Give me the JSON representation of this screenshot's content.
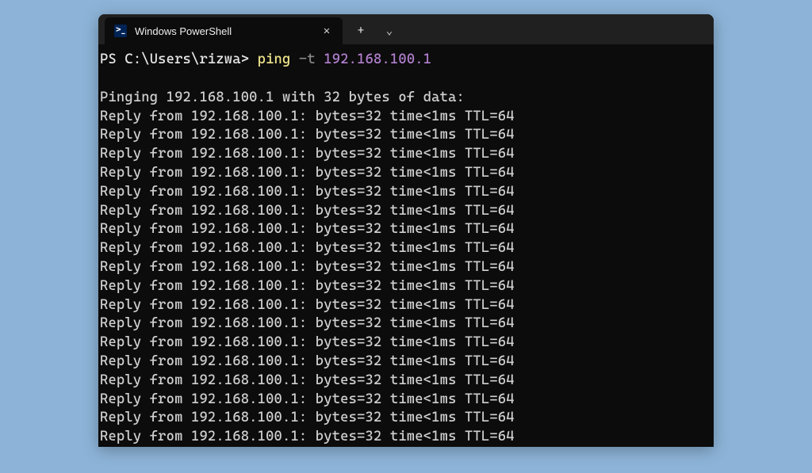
{
  "tab": {
    "title": "Windows PowerShell",
    "close_glyph": "✕",
    "new_tab_glyph": "+",
    "dropdown_glyph": "⌄"
  },
  "prompt": {
    "path": "PS C:\\Users\\rizwa> ",
    "command": "ping",
    "flag": " -t ",
    "arg": "192.168.100.1"
  },
  "output": {
    "header": "Pinging 192.168.100.1 with 32 bytes of data:",
    "reply": "Reply from 192.168.100.1: bytes=32 time<1ms TTL=64",
    "reply_count": 18
  }
}
